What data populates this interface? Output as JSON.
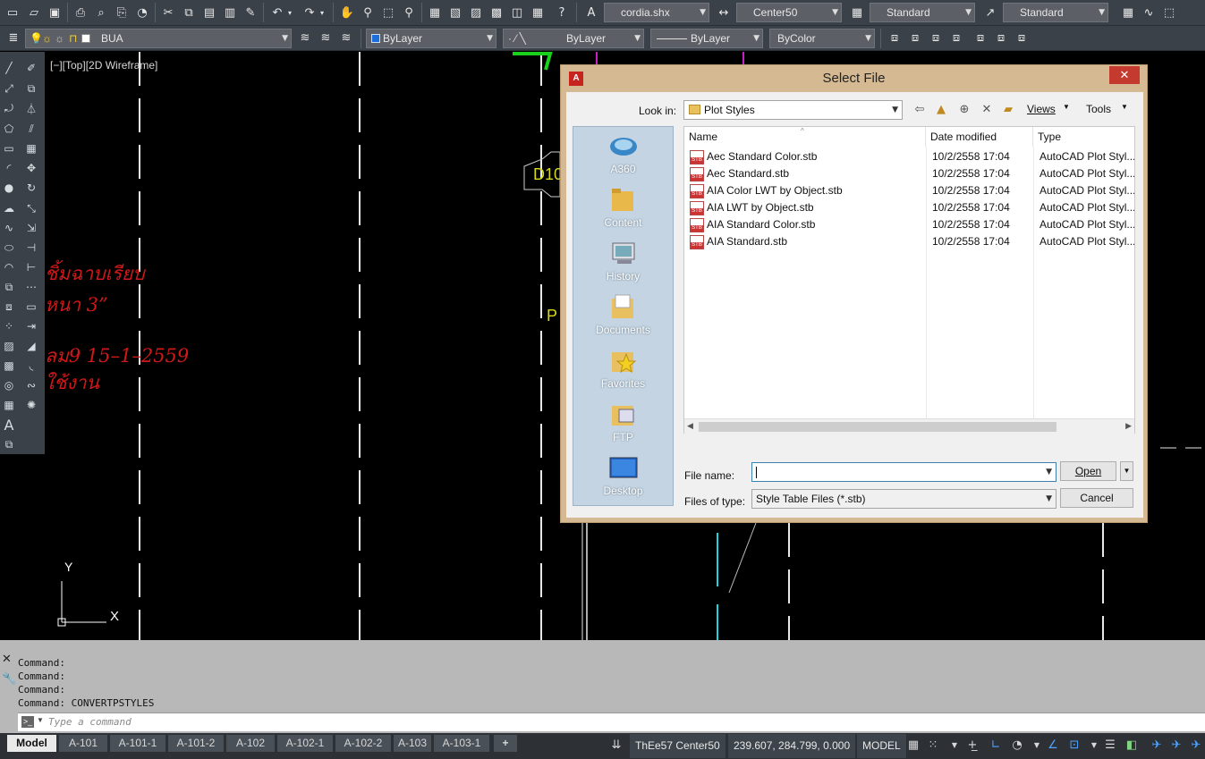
{
  "toolbar1": {
    "text_style": "cordia.shx",
    "dim_style": "Center50",
    "table_style": "Standard",
    "mleader_style": "Standard"
  },
  "toolbar2": {
    "layer": "BUA",
    "color": "ByLayer",
    "linetype": "ByLayer",
    "lineweight": "ByLayer",
    "plot_style": "ByColor"
  },
  "canvas": {
    "viewport_label": "[−][Top][2D Wireframe]",
    "thai_lines": [
      "ชิ้มฉาบเรียบ",
      "หนา 3”",
      "ลม9 15–1–2559",
      "ใช้งาน"
    ],
    "tag_d10": "D10",
    "tag_p": "P",
    "ucs_y": "Y",
    "ucs_x": "X"
  },
  "dialog": {
    "title": "Select File",
    "look_in_label": "Look in:",
    "look_in_value": "Plot Styles",
    "views_label": "Views",
    "tools_label": "Tools",
    "places": [
      "A360",
      "Content",
      "History",
      "Documents",
      "Favorites",
      "FTP",
      "Desktop"
    ],
    "columns": [
      "Name",
      "Date modified",
      "Type"
    ],
    "files": [
      {
        "name": "Aec Standard Color.stb",
        "date": "10/2/2558 17:04",
        "type": "AutoCAD Plot Styl..."
      },
      {
        "name": "Aec Standard.stb",
        "date": "10/2/2558 17:04",
        "type": "AutoCAD Plot Styl..."
      },
      {
        "name": "AIA Color LWT by Object.stb",
        "date": "10/2/2558 17:04",
        "type": "AutoCAD Plot Styl..."
      },
      {
        "name": "AIA LWT by Object.stb",
        "date": "10/2/2558 17:04",
        "type": "AutoCAD Plot Styl..."
      },
      {
        "name": "AIA Standard Color.stb",
        "date": "10/2/2558 17:04",
        "type": "AutoCAD Plot Styl..."
      },
      {
        "name": "AIA Standard.stb",
        "date": "10/2/2558 17:04",
        "type": "AutoCAD Plot Styl..."
      }
    ],
    "file_name_label": "File name:",
    "file_name_value": "",
    "file_type_label": "Files of type:",
    "file_type_value": "Style Table Files (*.stb)",
    "open_label": "Open",
    "cancel_label": "Cancel"
  },
  "command": {
    "history": [
      "Command:",
      "Command:",
      "Command:",
      "Command: CONVERTPSTYLES"
    ],
    "placeholder": "Type a command"
  },
  "status": {
    "tabs": [
      "Model",
      "A-101",
      "A-101-1",
      "A-101-2",
      "A-102",
      "A-102-1",
      "A-102-2",
      "A-103",
      "A-103-1"
    ],
    "add_tab": "+",
    "annotation": "ThEe57 Center50",
    "coords": "239.607, 284.799, 0.000",
    "space": "MODEL"
  },
  "colors": {
    "toolbar_bg": "#3b4148",
    "dialog_frame": "#d5b993",
    "thai_text": "#d11818",
    "cyan_line": "#1fd3e0",
    "magenta_line": "#c81ec8",
    "green_mark": "#19d11b"
  }
}
